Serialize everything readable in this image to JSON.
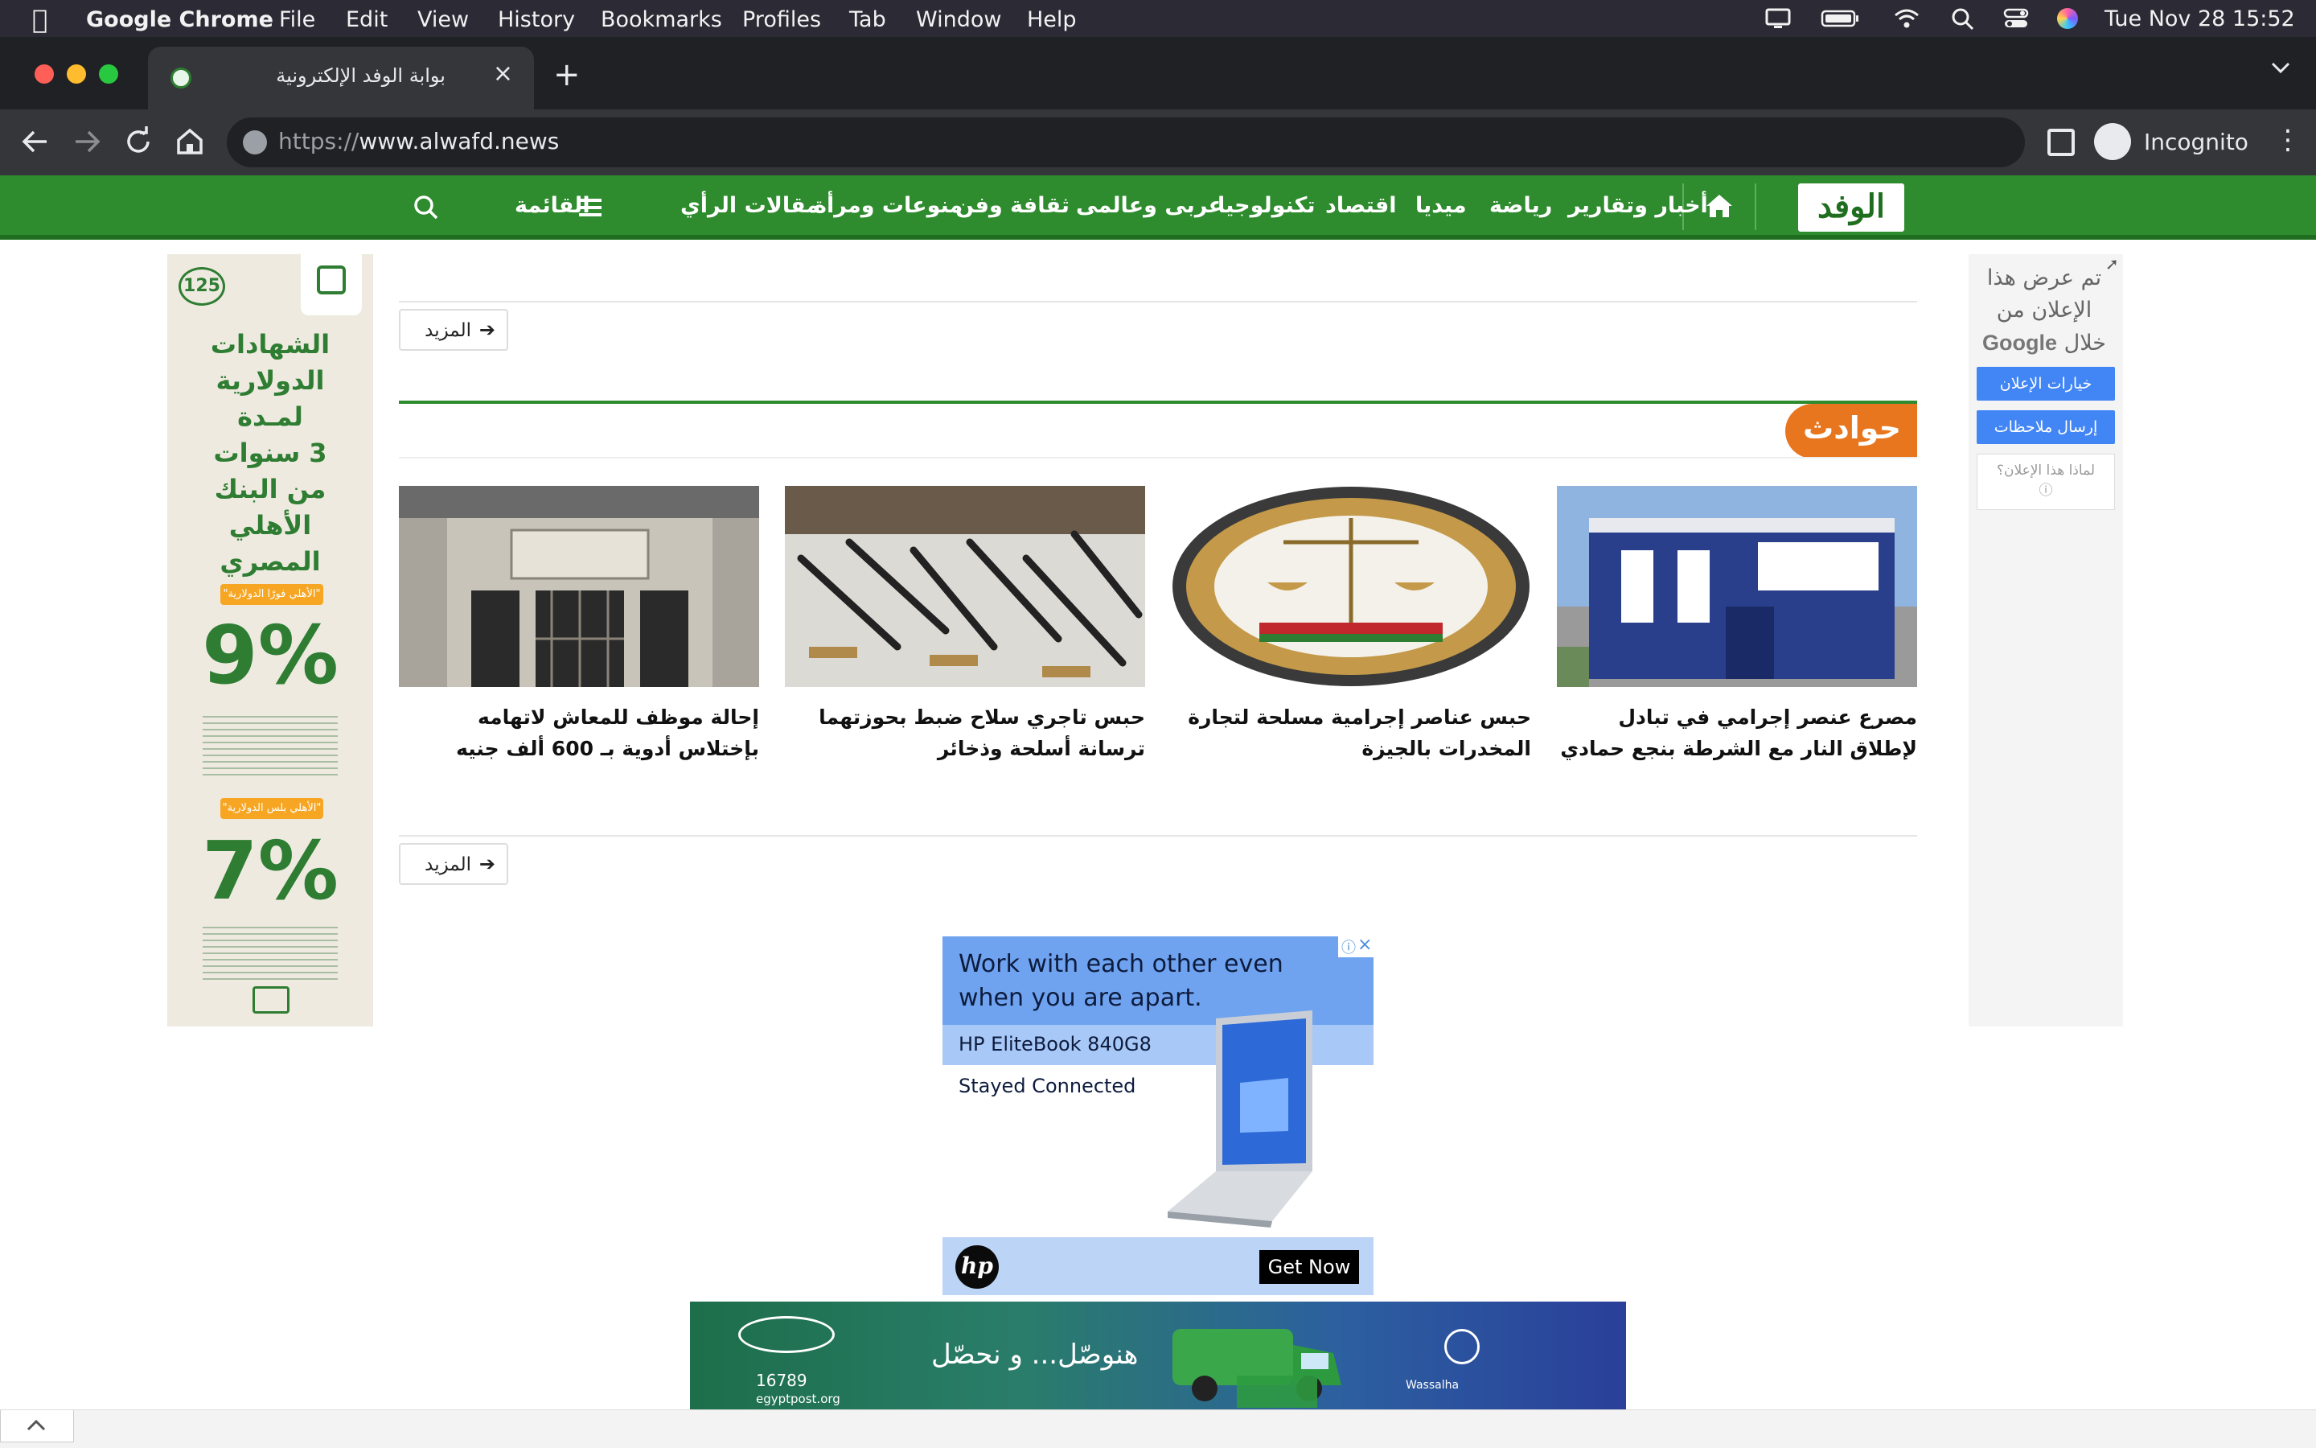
{
  "menubar": {
    "app": "Google Chrome",
    "items": [
      "File",
      "Edit",
      "View",
      "History",
      "Bookmarks",
      "Profiles",
      "Tab",
      "Window",
      "Help"
    ],
    "datetime": "Tue Nov 28  15:52"
  },
  "browser": {
    "tab_title": "بوابة الوفد الإلكترونية",
    "url_scheme": "https://",
    "url_host": "www.alwafd.news",
    "profile_label": "Incognito"
  },
  "site": {
    "logo_text": "الوفد",
    "nav": [
      "أخبار وتقارير",
      "رياضة",
      "ميديا",
      "اقتصاد",
      "تكنولوجيا",
      "عربى وعالمى",
      "ثقافة وفن",
      "منوعات ومرأة",
      "مقالات الرأي"
    ],
    "menu_label": "القائمة",
    "more_label": "المزيد",
    "section_title": "حوادث",
    "articles": [
      {
        "title": "مصرع عنصر إجرامي في تبادل لإطلاق النار مع الشرطة بنجع حمادي",
        "image": "police-station"
      },
      {
        "title": "حبس عناصر إجرامية مسلحة لتجارة المخدرات بالجيزة",
        "image": "prosecution-emblem"
      },
      {
        "title": "حبس تاجري سلاح ضبط بحوزتهما ترسانة أسلحة وذخائر",
        "image": "seized-weapons"
      },
      {
        "title": "إحالة موظف للمعاش لاتهامه بإختلاس أدوية بـ 600 ألف جنيه",
        "image": "state-council-building"
      }
    ]
  },
  "ads": {
    "left": {
      "lines": [
        "الشهادات",
        "الدولارية",
        "لمـدة",
        "3 سنوات",
        "من البنك",
        "الأهلي",
        "المصري"
      ],
      "badge1": "\"الأهلي فورًا الدولارية\"",
      "rate1": "9%",
      "badge2": "\"الأهلي بلس الدولارية\"",
      "rate2": "7%",
      "anniversary": "125"
    },
    "right": {
      "notice": "تم عرض هذا الإعلان من خلال",
      "google": "Google",
      "options_btn": "خيارات الإعلان",
      "feedback_btn": "إرسال ملاحظات",
      "why": "لماذا هذا الإعلان؟"
    },
    "hp": {
      "headline": "Work with each other even when you are apart.",
      "model": "HP EliteBook 840G8",
      "sub": "Stayed Connected",
      "logo": "hp",
      "cta": "Get Now"
    },
    "post": {
      "tagline": "هنوصّل... و نحصّل",
      "phone": "16789",
      "site": "egyptpost.org",
      "partner": "Wassalha"
    }
  },
  "colors": {
    "nav_green": "#2e8b2e",
    "section_orange": "#e8761e",
    "google_blue": "#4285f4"
  }
}
